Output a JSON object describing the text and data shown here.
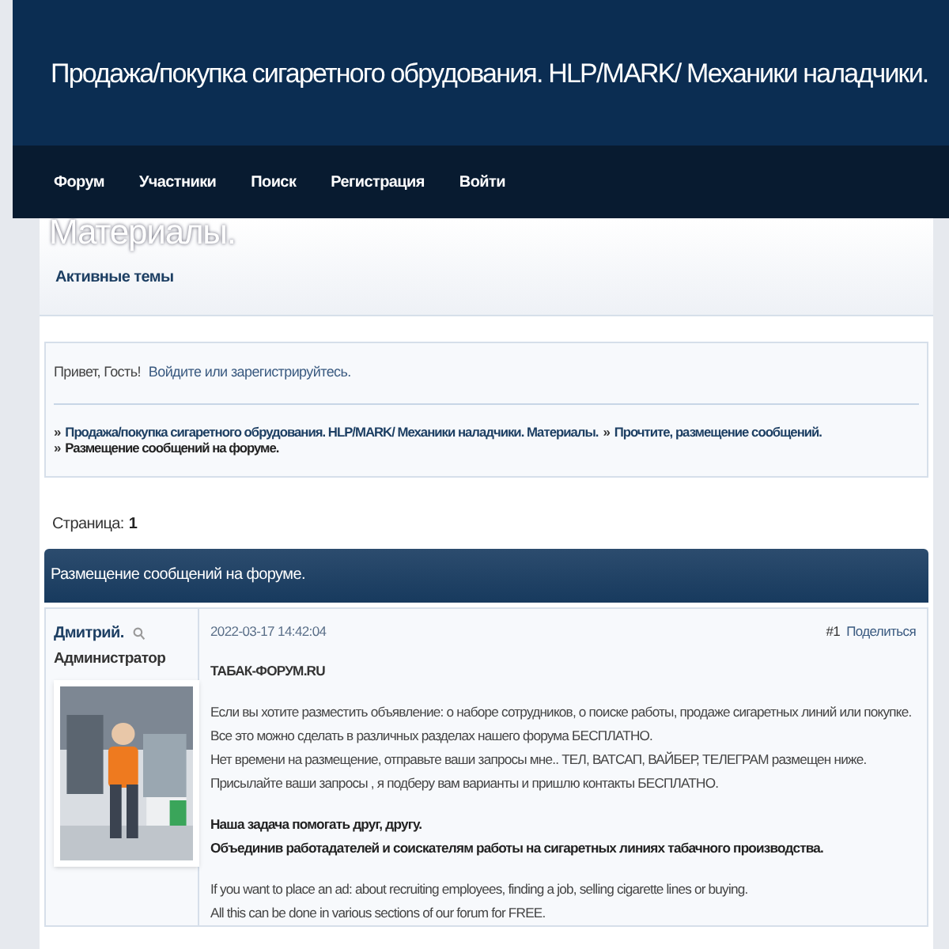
{
  "header": {
    "title": "Продажа/покупка сигаретного обрудования. HLP/MARK/ Механики наладчики.",
    "title_overflow": "Материалы."
  },
  "nav": [
    "Форум",
    "Участники",
    "Поиск",
    "Регистрация",
    "Войти"
  ],
  "subnav": [
    "Активные темы"
  ],
  "greeting": {
    "text": "Привет, Гость!",
    "link": "Войдите или зарегистрируйтесь."
  },
  "breadcrumbs": [
    {
      "separator": "»",
      "label": "Продажа/покупка сигаретного обрудования. HLP/MARK/ Механики наладчики. Материалы.",
      "link": true
    },
    {
      "separator": "»",
      "label": "Прочтите, размещение сообщений.",
      "link": true
    },
    {
      "separator": "»",
      "label": "Размещение сообщений на форуме.",
      "link": false
    }
  ],
  "pages": {
    "label": "Страница:",
    "current": "1"
  },
  "topic_title": "Размещение сообщений на форуме.",
  "post": {
    "author": "Дмитрий.",
    "role": "Администратор",
    "date": "2022-03-17 14:42:04",
    "number": "#1",
    "share": "Поделиться",
    "paragraphs": [
      {
        "kind": "heading",
        "lines": [
          "ТАБАК-ФОРУМ.RU"
        ]
      },
      {
        "kind": "plain",
        "lines": [
          "Если вы хотите разместить объявление: о наборе сотрудников, о поиске работы, продаже сигаретных линий или покупке.",
          "Все это можно сделать в различных разделах нашего форума БЕСПЛАТНО.",
          "Нет времени на размещение, отправьте ваши запросы мне.. ТЕЛ, ВАТСАП, ВАЙБЕР, ТЕЛЕГРАМ размещен ниже.",
          "Присылайте ваши запросы , я подберу вам варианты и пришлю контакты БЕСПЛАТНО."
        ]
      },
      {
        "kind": "bold",
        "lines": [
          "Наша задача помогать друг, другу.",
          "Объединив работадателей и соискателям работы на сигаретных линиях табачного производства."
        ]
      },
      {
        "kind": "plain",
        "lines": [
          "If you want to place an ad: about recruiting employees, finding a job, selling cigarette lines or buying.",
          "All this can be done in various sections of our forum for FREE."
        ]
      }
    ]
  }
}
